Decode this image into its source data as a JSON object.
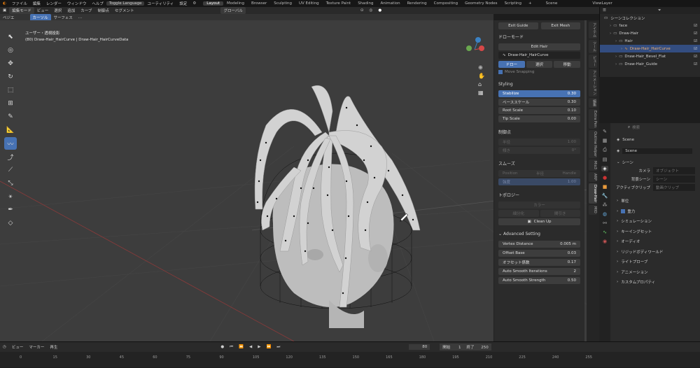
{
  "menu": {
    "items": [
      "ファイル",
      "編集",
      "レンダー",
      "ウィンドウ",
      "ヘルプ"
    ],
    "toggle_language": "Toggle Language",
    "items2": [
      "ユーティリティ",
      "設定"
    ],
    "workspaces": [
      "Layout",
      "Modeling",
      "Browser",
      "Sculpting",
      "UV Editing",
      "Texture Paint",
      "Shading",
      "Animation",
      "Rendering",
      "Compositing",
      "Geometry Nodes",
      "Scripting"
    ],
    "active_workspace": "Layout",
    "scene": "Scene",
    "view_layer": "ViewLayer"
  },
  "viewport_header": {
    "mode": "編集モード",
    "menus": [
      "ビュー",
      "選択",
      "追加",
      "カーブ",
      "制御点",
      "セグメント"
    ],
    "orientation": "グローバル"
  },
  "tool_header": {
    "stroke": "ベジエ",
    "cursor": "カーソル",
    "surface": "サーフェス"
  },
  "overlay_text": {
    "line1": "ユーザー・透視投影",
    "line2": "(80) Draw-Hair_HairCurve | Draw-Hair_HairCurveData"
  },
  "npanel": {
    "top_buttons": [
      "Exit Guide",
      "Exit Mesh"
    ],
    "drawmode_title": "ドローモード",
    "edit_hair": "Edit Hair",
    "object_field": "Draw-Hair_HairCurve",
    "tools": [
      "ドロー",
      "選択",
      "移動"
    ],
    "move_snapping": "Move Snapping",
    "styling_title": "Styling",
    "styling_rows": [
      {
        "label": "Stabilize",
        "value": "0.30",
        "selected": true
      },
      {
        "label": "ベーススケール",
        "value": "0.30",
        "selected": false
      },
      {
        "label": "Root Scale",
        "value": "0.10",
        "selected": false
      },
      {
        "label": "Tip Scale",
        "value": "0.00",
        "selected": false
      }
    ],
    "control_title": "制御点",
    "control_rows": [
      {
        "label": "半径",
        "value": "1.00"
      },
      {
        "label": "傾き",
        "value": "0°"
      }
    ],
    "smooth_title": "スムーズ",
    "smooth_cols": [
      "Position",
      "半径",
      "Handle"
    ],
    "smooth_strength_label": "強度",
    "smooth_strength_value": "1.00",
    "topology_title": "トポロジー",
    "topology_rows": [
      "カラー",
      "細分化",
      "間引き"
    ],
    "cleanup": "Clean Up",
    "advanced_title": "Advanced Setting",
    "advanced_rows": [
      {
        "label": "Vertex Distance",
        "value": "0.005 m"
      },
      {
        "label": "Offset Base",
        "value": "0.03"
      },
      {
        "label": "オフセット係数",
        "value": "0.17"
      },
      {
        "label": "Auto Smooth Iterations",
        "value": "2"
      },
      {
        "label": "Auto Smooth Strength",
        "value": "0.50"
      }
    ]
  },
  "ntabs": [
    "アイテム",
    "ツール",
    "ビュー",
    "アニメーション",
    "編集",
    "Extra Pen",
    "Outline Helper",
    "Mio3",
    "ARP",
    "Draw-Hair",
    "MIO"
  ],
  "outliner": {
    "title": "シーンコレクション",
    "rows": [
      {
        "label": "face",
        "indent": 1,
        "selected": false
      },
      {
        "label": "Draw-Hair",
        "indent": 1,
        "selected": false
      },
      {
        "label": "Hair",
        "indent": 2,
        "selected": false
      },
      {
        "label": "Draw-Hair_HairCurve",
        "indent": 3,
        "selected": true
      },
      {
        "label": "Draw-Hair_Bevel_Flat",
        "indent": 2,
        "selected": false
      },
      {
        "label": "Draw-Hair_Guide",
        "indent": 2,
        "selected": false
      }
    ]
  },
  "properties": {
    "search_placeholder": "検索",
    "scene_label": "Scene",
    "scene_field": "Scene",
    "section_title": "シーン",
    "camera_label": "カメラ",
    "camera_value": "オブジェクト",
    "bg_scene_label": "背景シーン",
    "bg_scene_value": "シーン",
    "active_clip_label": "アクティブクリップ",
    "active_clip_value": "動画クリップ",
    "sections": [
      "単位",
      "重力",
      "シミュレーション",
      "キーイングセット",
      "オーディオ",
      "リジッドボディワールド",
      "ライトプローブ",
      "アニメーション",
      "カスタムプロパティ"
    ]
  },
  "timeline": {
    "menus": [
      "ビュー",
      "マーカー",
      "再生"
    ],
    "current_frame": "80",
    "start_label": "開始",
    "start_value": "1",
    "end_label": "終了",
    "end_value": "250",
    "ticks": [
      "0",
      "15",
      "30",
      "45",
      "60",
      "75",
      "90",
      "105",
      "120",
      "135",
      "150",
      "165",
      "180",
      "195",
      "210",
      "225",
      "240",
      "255"
    ],
    "playhead": "80"
  },
  "colors": {
    "accent": "#4772b3",
    "viewport_bg": "#3d3d3d",
    "panel_bg": "#2b2b2b"
  }
}
